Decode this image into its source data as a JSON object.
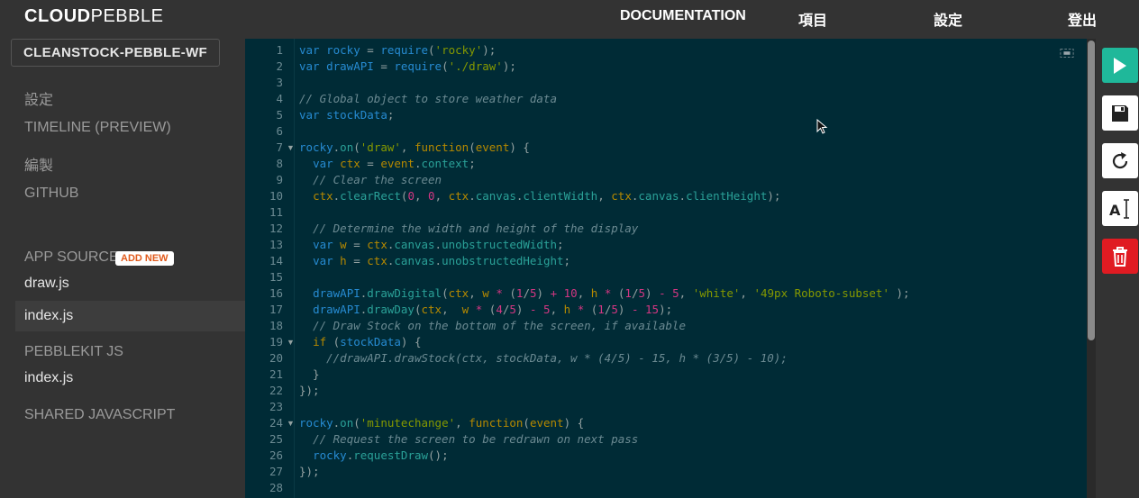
{
  "header": {
    "logo_bold": "CLOUD",
    "logo_light": "PEBBLE",
    "nav": [
      "DOCUMENTATION",
      "項目",
      "設定",
      "登出"
    ]
  },
  "sidebar": {
    "project_name": "CLEANSTOCK-PEBBLE-WF",
    "items": [
      "設定",
      "TIMELINE (PREVIEW)",
      "編製",
      "GITHUB"
    ],
    "app_source_label": "APP SOURCE",
    "add_new_label": "ADD NEW",
    "app_source_files": [
      "draw.js",
      "index.js"
    ],
    "pebblekit_label": "PEBBLEKIT JS",
    "pebblekit_files": [
      "index.js"
    ],
    "shared_label": "SHARED JAVASCRIPT",
    "active_file": "index.js"
  },
  "editor": {
    "line_numbers": [
      "1",
      "2",
      "3",
      "4",
      "5",
      "6",
      "7",
      "8",
      "9",
      "10",
      "11",
      "12",
      "13",
      "14",
      "15",
      "16",
      "17",
      "18",
      "19",
      "20",
      "21",
      "22",
      "23",
      "24",
      "25",
      "26",
      "27",
      "28"
    ],
    "folded_lines": [
      7,
      19,
      24
    ]
  },
  "toolbar": {
    "buttons": [
      "run",
      "save",
      "reload",
      "format",
      "delete"
    ]
  },
  "colors": {
    "editor_bg": "#002b36",
    "run": "#1fb89a",
    "delete": "#e01b22",
    "sidebar_bg": "#333333"
  }
}
